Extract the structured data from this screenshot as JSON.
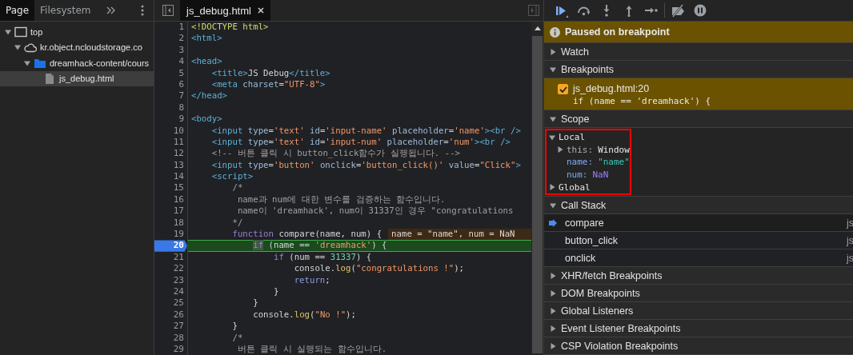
{
  "navigator": {
    "tabs": [
      {
        "label": "Page",
        "selected": true
      },
      {
        "label": "Filesystem",
        "selected": false
      }
    ],
    "tree": [
      {
        "label": "top",
        "kind": "frame",
        "expanded": true,
        "selected": false,
        "children": [
          {
            "label": "kr.object.ncloudstorage.co",
            "kind": "cloud",
            "expanded": true,
            "selected": false,
            "children": [
              {
                "label": "dreamhack-content/cours",
                "kind": "folder",
                "expanded": true,
                "selected": false,
                "children": [
                  {
                    "label": "js_debug.html",
                    "kind": "file",
                    "selected": true
                  }
                ]
              }
            ]
          }
        ]
      }
    ]
  },
  "editor": {
    "tabs": [
      {
        "label": "js_debug.html",
        "selected": true
      }
    ],
    "lines": [
      {
        "number": "1",
        "current": false,
        "breakpoint": false,
        "tokens": [
          {
            "kind": "doctype",
            "text": "<!DOCTYPE html>"
          }
        ]
      },
      {
        "number": "2",
        "current": false,
        "breakpoint": false,
        "tokens": [
          {
            "kind": "tag",
            "text": "<html>"
          }
        ]
      },
      {
        "number": "3",
        "current": false,
        "breakpoint": false
      },
      {
        "number": "4",
        "current": false,
        "breakpoint": false,
        "tokens": [
          {
            "kind": "tag",
            "text": "<head>"
          }
        ]
      },
      {
        "number": "5",
        "current": false,
        "breakpoint": false,
        "tokens": [
          {
            "kind": "tag",
            "text": "    <title>"
          },
          {
            "kind": "plain",
            "text": "JS Debug"
          },
          {
            "kind": "tag",
            "text": "</title>"
          }
        ]
      },
      {
        "number": "6",
        "current": false,
        "breakpoint": false,
        "tokens": [
          {
            "kind": "tag",
            "text": "    <meta "
          },
          {
            "kind": "attr",
            "text": "charset"
          },
          {
            "kind": "plain",
            "text": "="
          },
          {
            "kind": "string",
            "text": "\"UTF-8\""
          },
          {
            "kind": "tag",
            "text": ">"
          }
        ]
      },
      {
        "number": "7",
        "current": false,
        "breakpoint": false,
        "tokens": [
          {
            "kind": "tag",
            "text": "</head>"
          }
        ]
      },
      {
        "number": "8",
        "current": false,
        "breakpoint": false
      },
      {
        "number": "9",
        "current": false,
        "breakpoint": false,
        "tokens": [
          {
            "kind": "tag",
            "text": "<body>"
          }
        ]
      },
      {
        "number": "10",
        "current": false,
        "breakpoint": false,
        "tokens": [
          {
            "kind": "tag",
            "text": "    <input "
          },
          {
            "kind": "attr",
            "text": "type"
          },
          {
            "kind": "plain",
            "text": "="
          },
          {
            "kind": "string",
            "text": "'text'"
          },
          {
            "kind": "attr",
            "text": " id"
          },
          {
            "kind": "plain",
            "text": "="
          },
          {
            "kind": "string",
            "text": "'input-name'"
          },
          {
            "kind": "attr",
            "text": " placeholder"
          },
          {
            "kind": "plain",
            "text": "="
          },
          {
            "kind": "string",
            "text": "'name'"
          },
          {
            "kind": "tag",
            "text": "><br />"
          }
        ]
      },
      {
        "number": "11",
        "current": false,
        "breakpoint": false,
        "tokens": [
          {
            "kind": "tag",
            "text": "    <input "
          },
          {
            "kind": "attr",
            "text": "type"
          },
          {
            "kind": "plain",
            "text": "="
          },
          {
            "kind": "string",
            "text": "'text'"
          },
          {
            "kind": "attr",
            "text": " id"
          },
          {
            "kind": "plain",
            "text": "="
          },
          {
            "kind": "string",
            "text": "'input-num'"
          },
          {
            "kind": "attr",
            "text": " placeholder"
          },
          {
            "kind": "plain",
            "text": "="
          },
          {
            "kind": "string",
            "text": "'num'"
          },
          {
            "kind": "tag",
            "text": "><br />"
          }
        ]
      },
      {
        "number": "12",
        "current": false,
        "breakpoint": false,
        "tokens": [
          {
            "kind": "comment",
            "text": "    <!-- 버튼 클릭 시 button_click함수가 실행됩니다. -->"
          }
        ]
      },
      {
        "number": "13",
        "current": false,
        "breakpoint": false,
        "tokens": [
          {
            "kind": "tag",
            "text": "    <input "
          },
          {
            "kind": "attr",
            "text": "type"
          },
          {
            "kind": "plain",
            "text": "="
          },
          {
            "kind": "string",
            "text": "'button'"
          },
          {
            "kind": "attr",
            "text": " onclick"
          },
          {
            "kind": "plain",
            "text": "="
          },
          {
            "kind": "string",
            "text": "'button_click()'"
          },
          {
            "kind": "attr",
            "text": " value"
          },
          {
            "kind": "plain",
            "text": "="
          },
          {
            "kind": "string",
            "text": "\"Click\""
          },
          {
            "kind": "tag",
            "text": ">"
          }
        ]
      },
      {
        "number": "14",
        "current": false,
        "breakpoint": false,
        "tokens": [
          {
            "kind": "tag",
            "text": "    <script>"
          }
        ]
      },
      {
        "number": "15",
        "current": false,
        "breakpoint": false,
        "tokens": [
          {
            "kind": "comment",
            "text": "        /*"
          }
        ]
      },
      {
        "number": "16",
        "current": false,
        "breakpoint": false,
        "tokens": [
          {
            "kind": "comment",
            "text": "         name과 num에 대한 변수를 검증하는 함수입니다."
          }
        ]
      },
      {
        "number": "17",
        "current": false,
        "breakpoint": false,
        "tokens": [
          {
            "kind": "comment",
            "text": "         name이 'dreamhack', num이 31337인 경우 \"congratulations"
          }
        ]
      },
      {
        "number": "18",
        "current": false,
        "breakpoint": false,
        "tokens": [
          {
            "kind": "comment",
            "text": "        */"
          }
        ]
      },
      {
        "number": "19",
        "current": false,
        "breakpoint": false,
        "tokens": [
          {
            "kind": "keyword",
            "text": "        function"
          },
          {
            "kind": "plain",
            "text": " compare(name, num) {"
          }
        ],
        "inline_value": "name = \"name\", num = NaN"
      },
      {
        "number": "20",
        "current": true,
        "breakpoint": true,
        "tokens": [
          {
            "kind": "keyword_paused",
            "text": "            if"
          },
          {
            "kind": "plain",
            "text": " (name == "
          },
          {
            "kind": "string",
            "text": "'dreamhack'"
          },
          {
            "kind": "plain",
            "text": ") {"
          }
        ]
      },
      {
        "number": "21",
        "current": false,
        "breakpoint": false,
        "tokens": [
          {
            "kind": "keyword",
            "text": "                if"
          },
          {
            "kind": "plain",
            "text": " (num == "
          },
          {
            "kind": "number",
            "text": "31337"
          },
          {
            "kind": "plain",
            "text": ") {"
          }
        ]
      },
      {
        "number": "22",
        "current": false,
        "breakpoint": false,
        "tokens": [
          {
            "kind": "plain",
            "text": "                    console."
          },
          {
            "kind": "method",
            "text": "log"
          },
          {
            "kind": "plain",
            "text": "("
          },
          {
            "kind": "string",
            "text": "\"congratulations !\""
          },
          {
            "kind": "plain",
            "text": ");"
          }
        ]
      },
      {
        "number": "23",
        "current": false,
        "breakpoint": false,
        "tokens": [
          {
            "kind": "return",
            "text": "                    return"
          },
          {
            "kind": "plain",
            "text": ";"
          }
        ]
      },
      {
        "number": "24",
        "current": false,
        "breakpoint": false,
        "tokens": [
          {
            "kind": "plain",
            "text": "                }"
          }
        ]
      },
      {
        "number": "25",
        "current": false,
        "breakpoint": false,
        "tokens": [
          {
            "kind": "plain",
            "text": "            }"
          }
        ]
      },
      {
        "number": "26",
        "current": false,
        "breakpoint": false,
        "tokens": [
          {
            "kind": "plain",
            "text": "            console."
          },
          {
            "kind": "method",
            "text": "log"
          },
          {
            "kind": "plain",
            "text": "("
          },
          {
            "kind": "string",
            "text": "\"No !\""
          },
          {
            "kind": "plain",
            "text": ");"
          }
        ]
      },
      {
        "number": "27",
        "current": false,
        "breakpoint": false,
        "tokens": [
          {
            "kind": "plain",
            "text": "        }"
          }
        ]
      },
      {
        "number": "28",
        "current": false,
        "breakpoint": false,
        "tokens": [
          {
            "kind": "comment",
            "text": "        /*"
          }
        ]
      },
      {
        "number": "29",
        "current": false,
        "breakpoint": false,
        "tokens": [
          {
            "kind": "comment",
            "text": "         버튼 클릭 시 실행되는 함수입니다."
          }
        ]
      }
    ]
  },
  "debugger": {
    "banner": "Paused on breakpoint",
    "sections": [
      {
        "title": "Watch",
        "expanded": false
      },
      {
        "title": "Breakpoints",
        "expanded": true,
        "breakpoints": [
          {
            "location": "js_debug.html:20",
            "code": "if (name == 'dreamhack') {",
            "checked": true
          }
        ]
      },
      {
        "title": "Scope",
        "expanded": true,
        "scopes": [
          {
            "name": "Local",
            "expanded": true,
            "variables": [
              {
                "name": "this:",
                "value": "Window",
                "kind": "object",
                "expanded": false
              },
              {
                "name": "name:",
                "value": "\"name\"",
                "kind": "string"
              },
              {
                "name": "num:",
                "value": "NaN",
                "kind": "number"
              }
            ]
          },
          {
            "name": "Global",
            "expanded": false
          }
        ]
      },
      {
        "title": "Call Stack",
        "expanded": true,
        "frames": [
          {
            "name": "compare",
            "location": "js",
            "selected": true
          },
          {
            "name": "button_click",
            "location": "js",
            "selected": false
          },
          {
            "name": "onclick",
            "location": "js",
            "selected": false
          }
        ]
      },
      {
        "title": "XHR/fetch Breakpoints",
        "expanded": false
      },
      {
        "title": "DOM Breakpoints",
        "expanded": false
      },
      {
        "title": "Global Listeners",
        "expanded": false
      },
      {
        "title": "Event Listener Breakpoints",
        "expanded": false
      },
      {
        "title": "CSP Violation Breakpoints",
        "expanded": false
      }
    ]
  }
}
